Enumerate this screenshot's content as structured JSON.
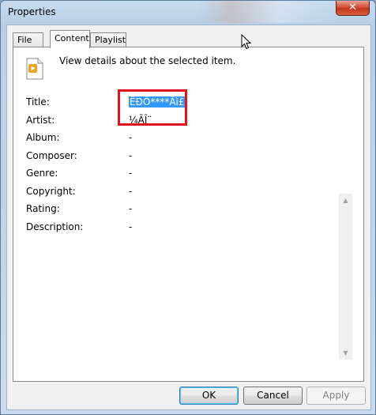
{
  "window": {
    "title": "Properties",
    "close_label": "✕"
  },
  "tabs": [
    {
      "label": "File",
      "active": false
    },
    {
      "label": "Content",
      "active": true
    },
    {
      "label": "Playlist",
      "active": false
    }
  ],
  "header": {
    "icon": "media-file-icon",
    "description": "View details about the selected item."
  },
  "fields": [
    {
      "label": "Title:",
      "value": "ËÐÖ****Ãì£",
      "selected": true
    },
    {
      "label": "Artist:",
      "value": "¼ÃÎ¨"
    },
    {
      "label": "Album:",
      "value": "-"
    },
    {
      "label": "Composer:",
      "value": "-"
    },
    {
      "label": "Genre:",
      "value": "-"
    },
    {
      "label": "Copyright:",
      "value": "-"
    },
    {
      "label": "Rating:",
      "value": "-"
    },
    {
      "label": "Description:",
      "value": "-"
    }
  ],
  "buttons": {
    "ok": "OK",
    "cancel": "Cancel",
    "apply": "Apply"
  },
  "colors": {
    "highlight_box": "#e0121a",
    "selection": "#3399ff"
  }
}
